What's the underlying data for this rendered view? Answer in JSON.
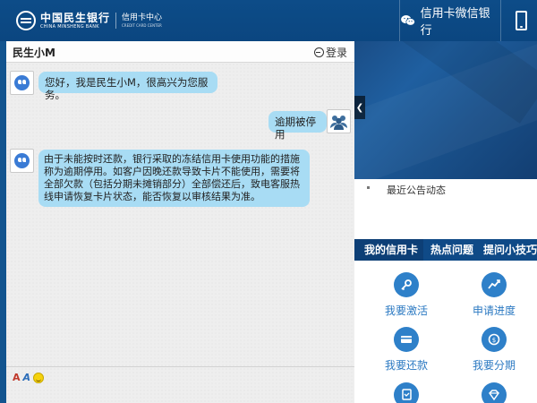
{
  "header": {
    "bank_name_cn": "中国民生银行",
    "bank_name_en": "CHINA MINSHENG BANK",
    "center_cn": "信用卡中心",
    "center_en": "CREDIT CARD CENTER",
    "wechat_bank": "信用卡微信银行"
  },
  "chat": {
    "title": "民生小M",
    "login_label": "登录",
    "messages": [
      {
        "sender": "bot",
        "text": "您好，我是民生小M，很高兴为您服务。"
      },
      {
        "sender": "user",
        "text": "逾期被停用"
      },
      {
        "sender": "bot",
        "text": "由于未能按时还款，银行采取的冻结信用卡使用功能的措施称为逾期停用。如客户因晚还款导致卡片不能使用，需要将全部欠款（包括分期未摊销部分）全部偿还后，致电客服热线申请恢复卡片状态，能否恢复以审核结果为准。"
      }
    ],
    "tool_font_label": "A",
    "tool_font2_label": "A"
  },
  "notice": {
    "title": "最近公告动态"
  },
  "card_panel": {
    "tabs": [
      {
        "label": "我的信用卡"
      },
      {
        "label": "热点问题"
      },
      {
        "label": "提问小技巧"
      }
    ],
    "items": [
      {
        "label": "我要激活",
        "icon": "key-icon"
      },
      {
        "label": "申请进度",
        "icon": "chart-icon"
      },
      {
        "label": "我要还款",
        "icon": "card-icon"
      },
      {
        "label": "我要分期",
        "icon": "installment-icon"
      },
      {
        "label": "",
        "icon": "document-icon"
      },
      {
        "label": "",
        "icon": "diamond-icon"
      }
    ]
  },
  "colors": {
    "header_bg": "#0d4c88",
    "bubble_bg": "#a8dcf4",
    "tab_bg": "#0f4a87",
    "icon_blue": "#2e80c9",
    "label_blue": "#2b79c2"
  }
}
